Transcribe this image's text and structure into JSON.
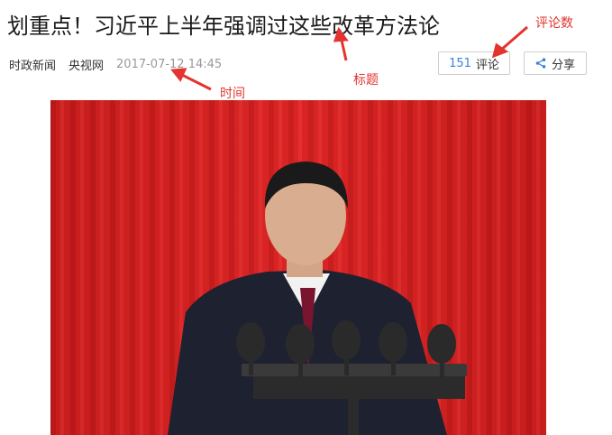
{
  "article": {
    "title": "划重点！习近平上半年强调过这些改革方法论",
    "channel": "时政新闻",
    "source": "央视网",
    "time": "2017-07-12 14:45"
  },
  "actions": {
    "comment_count": "151",
    "comment_label": "评论",
    "share_label": "分享",
    "share_icon": "share-icon"
  },
  "annotations": {
    "comment_count": "评论数",
    "title": "标题",
    "time": "时间"
  },
  "colors": {
    "annotation": "#e3342f",
    "count": "#3a83d9",
    "curtain": "#d92222"
  }
}
